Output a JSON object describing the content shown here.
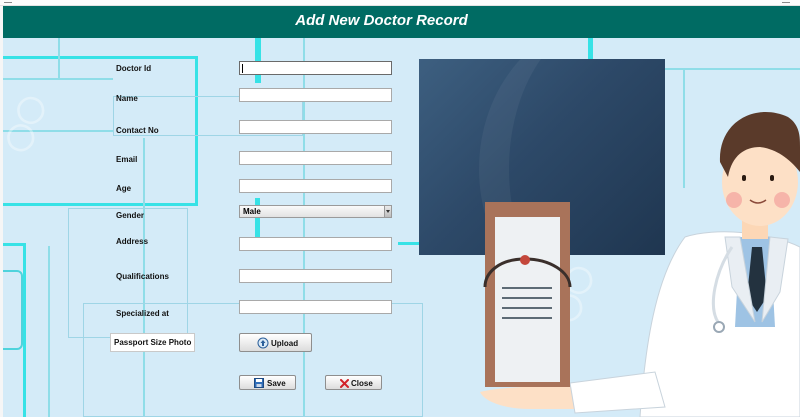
{
  "window": {
    "title": "Add New Doctor Record"
  },
  "form": {
    "fields": [
      {
        "label": "Doctor Id",
        "value": ""
      },
      {
        "label": "Name",
        "value": ""
      },
      {
        "label": "Contact No",
        "value": ""
      },
      {
        "label": "Email",
        "value": ""
      },
      {
        "label": "Age",
        "value": ""
      },
      {
        "label": "Gender",
        "value": "Male"
      },
      {
        "label": "Address",
        "value": ""
      },
      {
        "label": "Qualifications",
        "value": ""
      },
      {
        "label": "Specialized at",
        "value": ""
      }
    ],
    "photo_label": "Passport Size Photo"
  },
  "buttons": {
    "upload": "Upload",
    "save": "Save",
    "close": "Close"
  },
  "colors": {
    "header": "#006b63",
    "background": "#d4ebf8",
    "photo_placeholder": "#2d4968"
  }
}
